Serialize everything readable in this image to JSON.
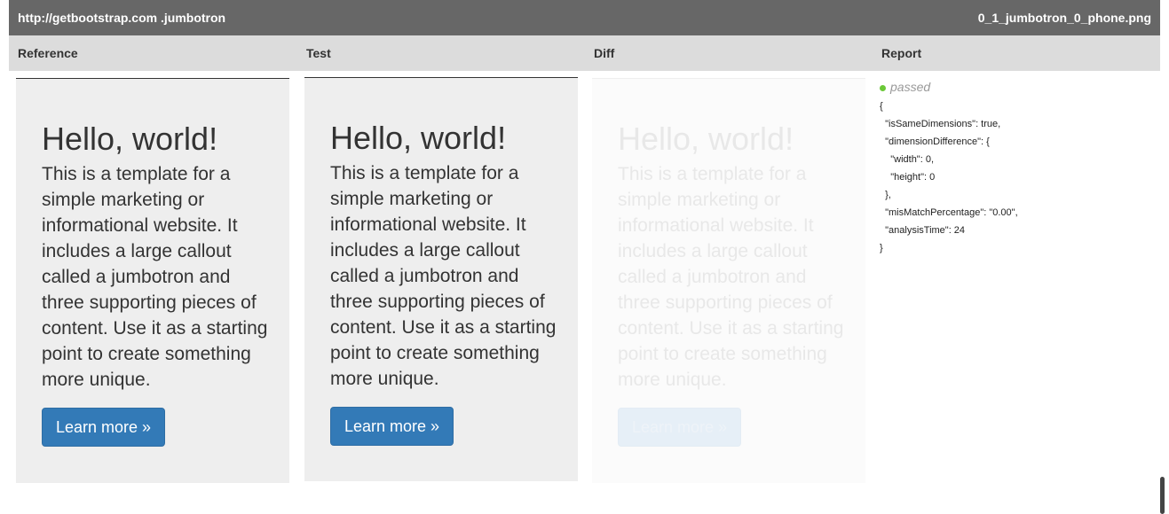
{
  "topbar": {
    "url": "http://getbootstrap.com .jumbotron",
    "filename": "0_1_jumbotron_0_phone.png"
  },
  "columns": {
    "reference": "Reference",
    "test": "Test",
    "diff": "Diff",
    "report": "Report"
  },
  "jumbotron": {
    "heading": "Hello, world!",
    "text": "This is a template for a simple marketing or informational website. It includes a large callout called a jumbotron and three supporting pieces of content. Use it as a starting point to create something more unique.",
    "button": "Learn more »"
  },
  "report": {
    "status": "passed",
    "status_color": "#6bc838",
    "json": "{\n  \"isSameDimensions\": true,\n  \"dimensionDifference\": {\n    \"width\": 0,\n    \"height\": 0\n  },\n  \"misMatchPercentage\": \"0.00\",\n  \"analysisTime\": 24\n}"
  }
}
